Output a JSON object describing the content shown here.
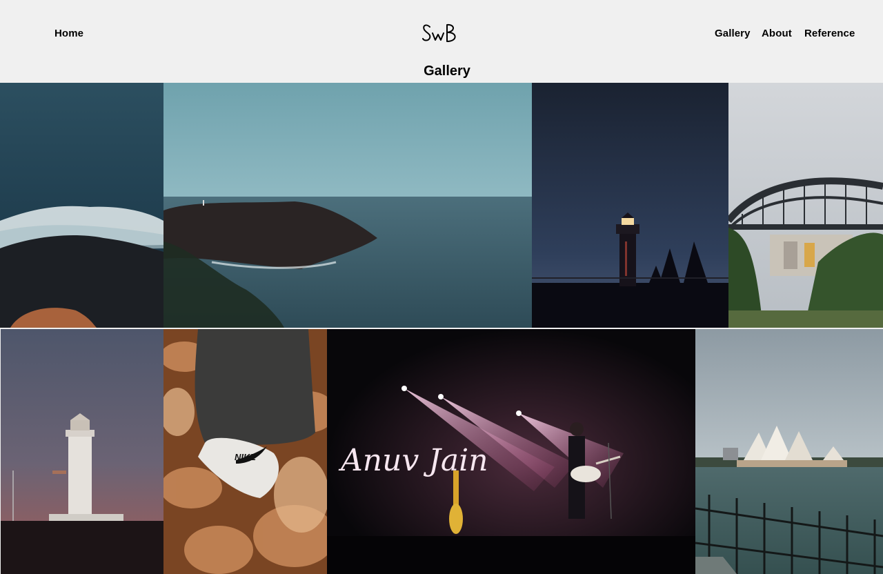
{
  "header": {
    "home_label": "Home",
    "logo_text": "SwB",
    "nav": {
      "gallery_label": "Gallery",
      "about_label": "About",
      "reference_label": "Reference"
    }
  },
  "page": {
    "title": "Gallery"
  },
  "gallery": {
    "photos": [
      {
        "subject": "ocean waves crashing on rocks"
      },
      {
        "subject": "rocky headland with lighthouse over calm sea"
      },
      {
        "subject": "lighthouse at night"
      },
      {
        "subject": "harbour bridge"
      },
      {
        "subject": "white lighthouse at dusk"
      },
      {
        "subject": "sneaker in autumn leaves"
      },
      {
        "subject": "musician on stage",
        "caption": "Anuv Jain",
        "shoe_brand": "NIKE"
      },
      {
        "subject": "opera house across the harbour"
      }
    ]
  }
}
